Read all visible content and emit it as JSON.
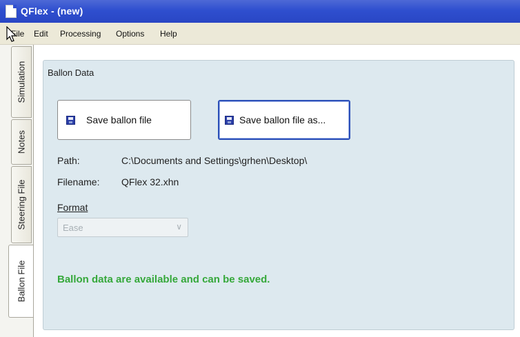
{
  "window": {
    "title": "QFlex - (new)"
  },
  "menu": {
    "file": "File",
    "items": [
      "Edit",
      "Processing",
      "Options",
      "Help"
    ]
  },
  "tabs": [
    {
      "label": "Simulation",
      "active": false
    },
    {
      "label": "Notes",
      "active": false
    },
    {
      "label": "Steering File",
      "active": false
    },
    {
      "label": "Ballon File",
      "active": true
    }
  ],
  "panel": {
    "title": "Ballon Data",
    "save_button": "Save ballon file",
    "save_as_button": "Save ballon file as...",
    "path_label": "Path:",
    "path_value": "C:\\Documents and Settings\\grhen\\Desktop\\",
    "filename_label": "Filename:",
    "filename_value": "QFlex 32.xhn",
    "format_label": "Format",
    "format_value": "Ease",
    "status": "Ballon data are available and can be saved."
  },
  "colors": {
    "titlebar": "#2f4fcf",
    "panel_bg": "#dde9ef",
    "status_text": "#35a83a",
    "focus_border": "#2b4fb8"
  },
  "icons": {
    "app": "document-icon",
    "save": "floppy-disk-icon",
    "dropdown": "chevron-down-icon"
  }
}
